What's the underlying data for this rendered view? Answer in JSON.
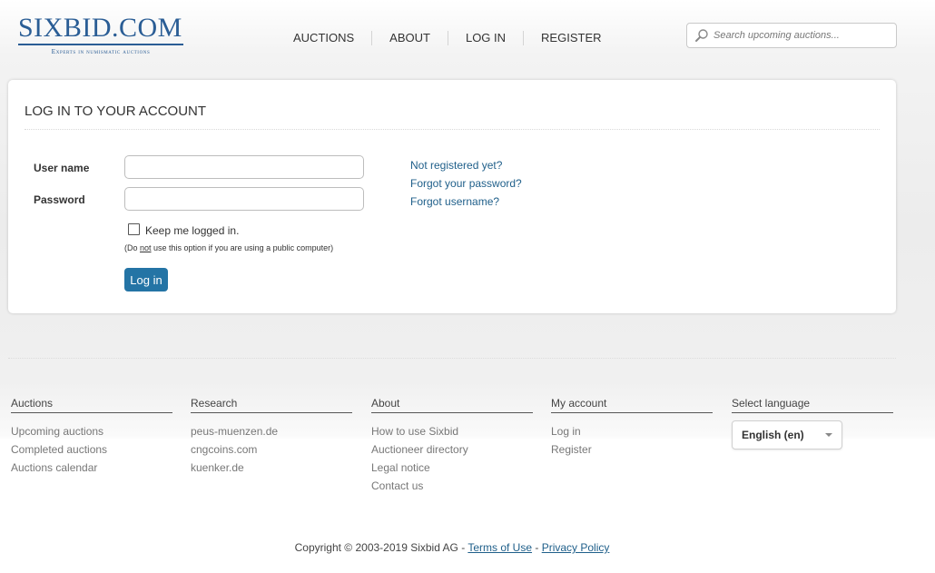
{
  "logo": {
    "main": "SIXBID.COM",
    "tagline": "Experts in numismatic auctions"
  },
  "nav": {
    "items": [
      {
        "label": "AUCTIONS"
      },
      {
        "label": "ABOUT"
      },
      {
        "label": "LOG IN"
      },
      {
        "label": "REGISTER"
      }
    ]
  },
  "search": {
    "placeholder": "Search upcoming auctions...",
    "icon": "search-icon"
  },
  "login": {
    "title": "LOG IN TO YOUR ACCOUNT",
    "username_label": "User name",
    "password_label": "Password",
    "username_value": "",
    "password_value": "",
    "keep_logged_label": "Keep me logged in.",
    "note_prefix": "(Do ",
    "note_emph": "not",
    "note_suffix": " use this option if you are using a public computer)",
    "submit_label": "Log in",
    "links": [
      {
        "label": "Not registered yet?"
      },
      {
        "label": "Forgot your password?"
      },
      {
        "label": "Forgot username?"
      }
    ]
  },
  "footer": {
    "columns": [
      {
        "heading": "Auctions",
        "links": [
          "Upcoming auctions",
          "Completed auctions",
          "Auctions calendar"
        ]
      },
      {
        "heading": "Research",
        "links": [
          "peus-muenzen.de",
          "cngcoins.com",
          "kuenker.de"
        ]
      },
      {
        "heading": "About",
        "links": [
          "How to use Sixbid",
          "Auctioneer directory",
          "Legal notice",
          "Contact us"
        ]
      },
      {
        "heading": "My account",
        "links": [
          "Log in",
          "Register"
        ]
      }
    ],
    "language": {
      "heading": "Select language",
      "selected": "English (en)"
    },
    "copyright": {
      "text": "Copyright © 2003-2019 Sixbid AG - ",
      "terms": "Terms of Use",
      "separator": " - ",
      "privacy": "Privacy Policy"
    }
  },
  "colors": {
    "brand": "#2a5d95",
    "button": "#2474a5",
    "link": "#1f5f8a"
  }
}
